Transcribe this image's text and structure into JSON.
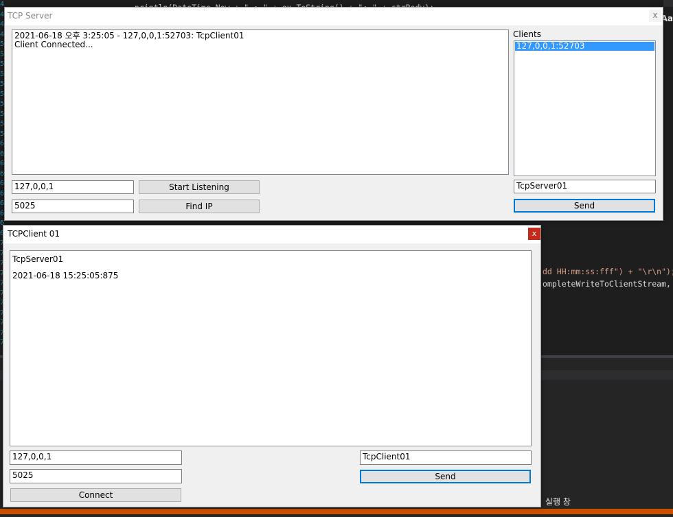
{
  "ide": {
    "code_lines": [
      "println(DateTime.Now + \" : \" + ex.ToString() + \": \" + strBody);",
      "dd HH:mm:ss:fff\") + \"\\r\\n\");",
      "ompleteWriteToClientStream,"
    ],
    "line_numbers": [
      "4",
      "4",
      "4",
      "4",
      "5",
      "5",
      "5",
      "5",
      "5",
      "5",
      "5",
      "5",
      "5",
      "5",
      "6",
      "6",
      "6",
      "6",
      "6",
      "6",
      "6",
      "6",
      "6",
      "6",
      "7",
      "7",
      "7",
      "7",
      "7",
      "7",
      "7",
      "7",
      "7",
      "7",
      "7"
    ],
    "glyph_label": "Aa",
    "bottom_tab_label": "실행 창"
  },
  "server_window": {
    "title": "TCP Server",
    "close_label": "x",
    "log_lines": [
      "2021-06-18 오후 3:25:05 - 127,0,0,1:52703: TcpClient01",
      "Client Connected..."
    ],
    "clients_label": "Clients",
    "clients": [
      "127,0,0,1:52703"
    ],
    "ip_value": "127,0,0,1",
    "port_value": "5025",
    "start_button": "Start Listening",
    "find_ip_button": "Find IP",
    "message_value": "TcpServer01",
    "send_button": "Send"
  },
  "client_window": {
    "title": "TCPClient 01",
    "close_label": "x",
    "close_color": "#c42b1c",
    "log_lines": [
      "TcpServer01",
      "2021-06-18 15:25:05:875"
    ],
    "ip_value": "127,0,0,1",
    "port_value": "5025",
    "connect_button": "Connect",
    "message_value": "TcpClient01",
    "send_button": "Send"
  }
}
